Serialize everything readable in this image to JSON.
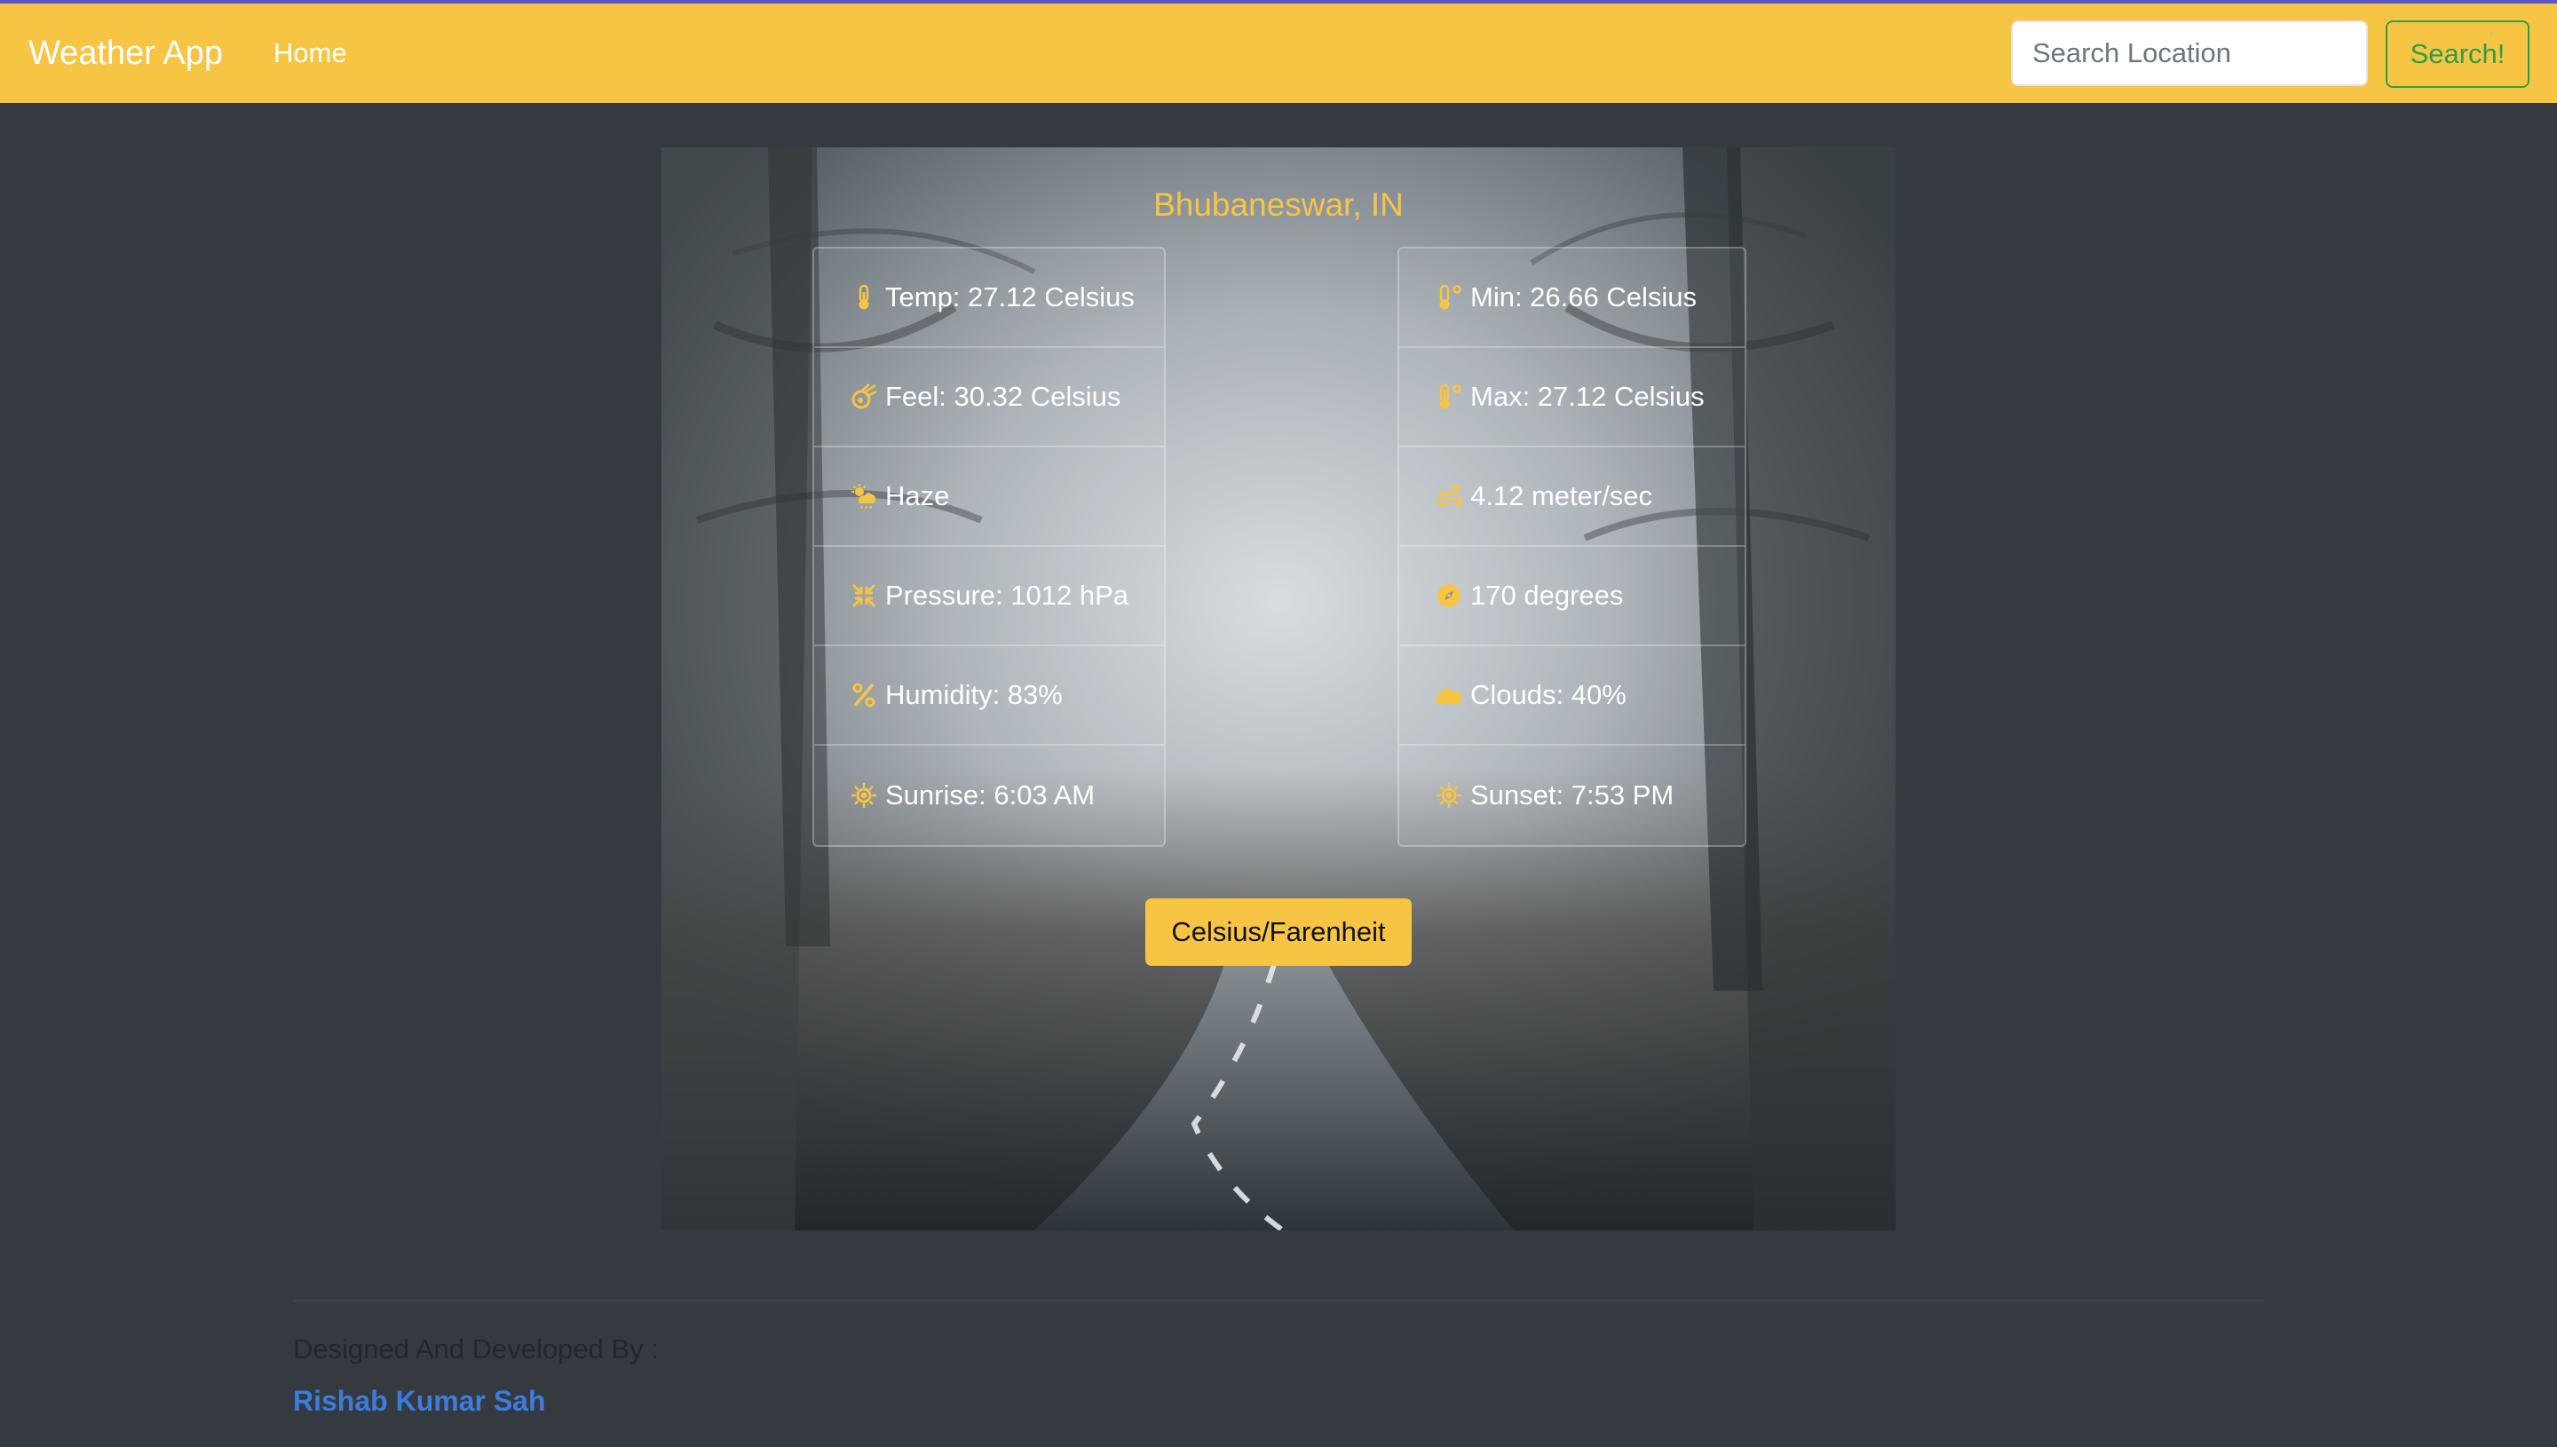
{
  "navbar": {
    "brand": "Weather App",
    "home_label": "Home",
    "search_placeholder": "Search Location",
    "search_button": "Search!"
  },
  "weather": {
    "location": "Bhubaneswar, IN",
    "left": [
      {
        "icon": "thermometer-icon",
        "text": "Temp: 27.12 Celsius"
      },
      {
        "icon": "meteor-icon",
        "text": "Feel: 30.32 Celsius"
      },
      {
        "icon": "cloud-sun-rain-icon",
        "text": "Haze"
      },
      {
        "icon": "compress-icon",
        "text": "Pressure: 1012 hPa"
      },
      {
        "icon": "percent-icon",
        "text": "Humidity: 83%"
      },
      {
        "icon": "sun-icon",
        "text": "Sunrise: 6:03 AM"
      }
    ],
    "right": [
      {
        "icon": "temperature-low-icon",
        "text": "Min: 26.66 Celsius"
      },
      {
        "icon": "temperature-high-icon",
        "text": "Max: 27.12 Celsius"
      },
      {
        "icon": "wind-icon",
        "text": "4.12 meter/sec"
      },
      {
        "icon": "compass-icon",
        "text": "170 degrees"
      },
      {
        "icon": "cloud-icon",
        "text": "Clouds: 40%"
      },
      {
        "icon": "sun-icon",
        "text": "Sunset: 7:53 PM"
      }
    ],
    "toggle_label": "Celsius/Farenheit"
  },
  "footer": {
    "label": "Designed And Developed By :",
    "author": "Rishab Kumar Sah"
  },
  "colors": {
    "accent": "#f7c544",
    "background": "#343a40",
    "success": "#2e9e47",
    "link": "#3b7ddd"
  }
}
